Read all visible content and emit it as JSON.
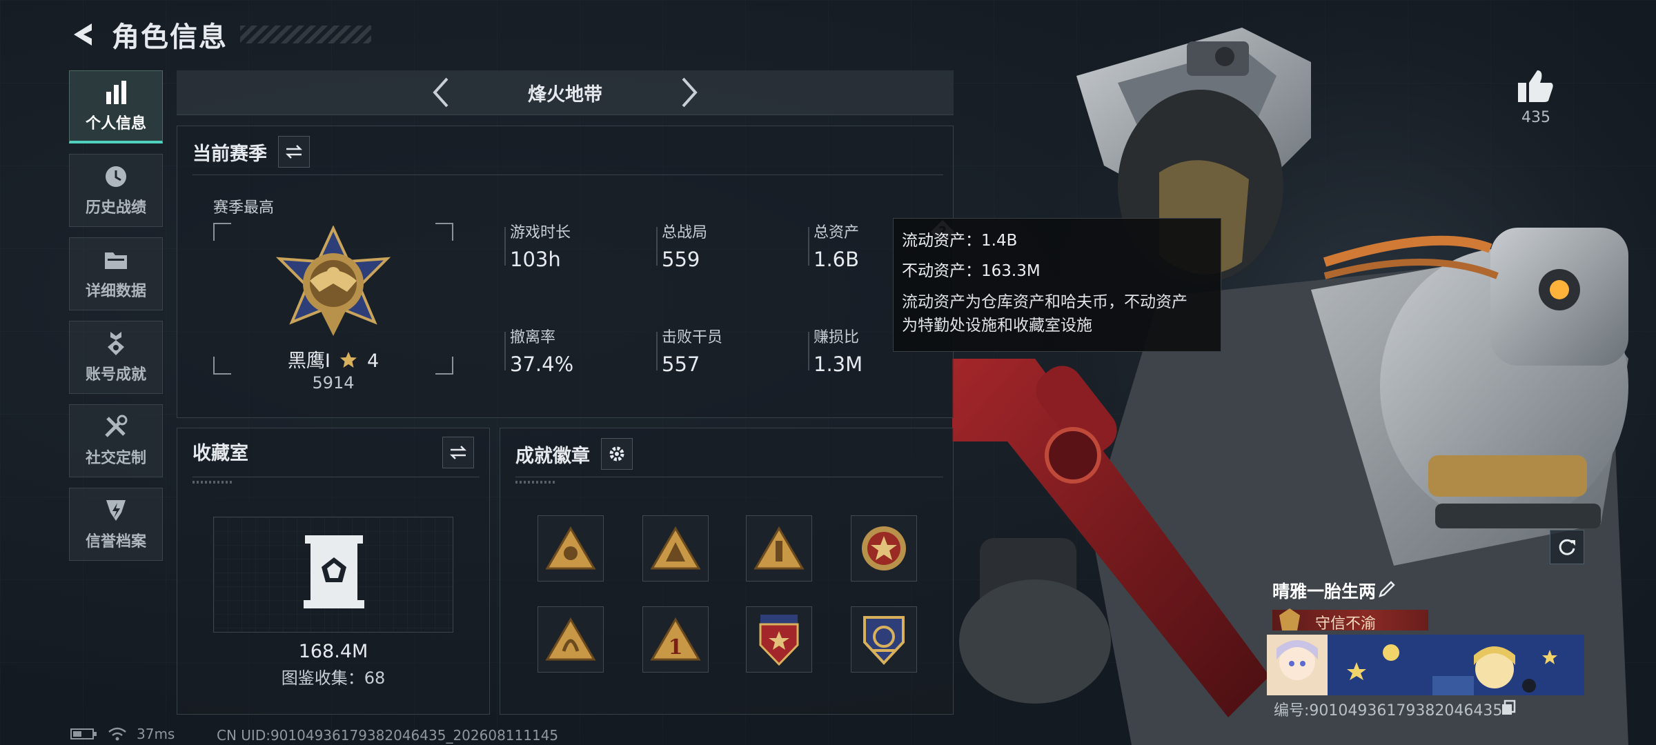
{
  "header": {
    "title": "角色信息"
  },
  "sidebar": {
    "items": [
      {
        "label": "个人信息",
        "icon": "bar-chart-icon",
        "active": true
      },
      {
        "label": "历史战绩",
        "icon": "clock-history-icon",
        "active": false
      },
      {
        "label": "详细数据",
        "icon": "folder-icon",
        "active": false
      },
      {
        "label": "账号成就",
        "icon": "medal-icon",
        "active": false
      },
      {
        "label": "社交定制",
        "icon": "tools-icon",
        "active": false
      },
      {
        "label": "信誉档案",
        "icon": "shield-lightning-icon",
        "active": false
      }
    ]
  },
  "mode": {
    "title": "烽火地带"
  },
  "season": {
    "title": "当前赛季",
    "best_label": "赛季最高",
    "rank_name": "黑鹰I",
    "rank_stars": "4",
    "rank_score": "5914",
    "stats": [
      {
        "label": "游戏时长",
        "value": "103h"
      },
      {
        "label": "总战局",
        "value": "559"
      },
      {
        "label": "总资产",
        "value": "1.6B"
      },
      {
        "label": "撤离率",
        "value": "37.4%"
      },
      {
        "label": "击败干员",
        "value": "557"
      },
      {
        "label": "赚损比",
        "value": "1.3M"
      }
    ]
  },
  "tooltip": {
    "liquid": "流动资产：1.4B",
    "fixed": "不动资产：163.3M",
    "desc_line1": "流动资产为仓库资产和哈夫币，不动资产",
    "desc_line2": "为特勤处设施和收藏室设施"
  },
  "collection": {
    "title": "收藏室",
    "value": "168.4M",
    "sub": "图鉴收集：68"
  },
  "badges": {
    "title": "成就徽章"
  },
  "likes": {
    "count": "435"
  },
  "profile": {
    "name": "晴雅一胎生两",
    "title": "守信不渝",
    "id": "编号:9010493617938204643​5"
  },
  "status": {
    "ping": "37ms",
    "uid": "CN UID:9010493617938204643​5_202608111145"
  },
  "colors": {
    "accent": "#4fd1bd",
    "gold": "#c9a45a",
    "panel": "#1c2229"
  }
}
